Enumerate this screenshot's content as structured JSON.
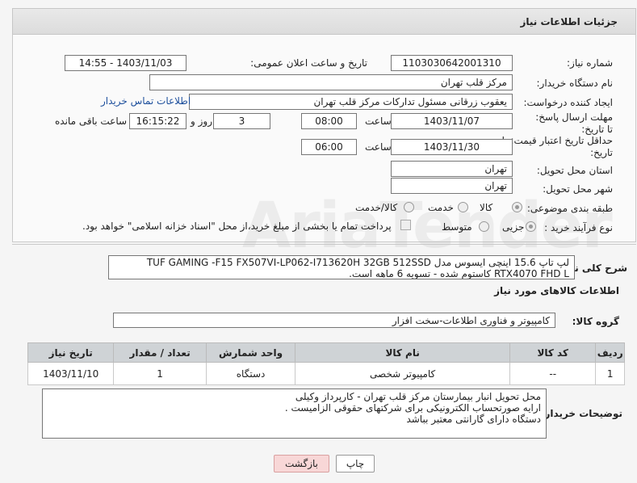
{
  "header": {
    "title": "جزئیات اطلاعات نیاز"
  },
  "fields": {
    "need_number_label": "شماره نیاز:",
    "need_number": "1103030642001310",
    "announce_label": "تاریخ و ساعت اعلان عمومی:",
    "announce_value": "1403/11/03 - 14:55",
    "buyer_org_label": "نام دستگاه خریدار:",
    "buyer_org": "مرکز قلب تهران",
    "creator_label": "ایجاد کننده درخواست:",
    "creator": "یعقوب زرقانی مسئول تدارکات مرکز قلب تهران",
    "contact_link": "اطلاعات تماس خریدار",
    "deadline_label": "مهلت ارسال پاسخ: تا تاریخ:",
    "deadline_date": "1403/11/07",
    "time_label": "ساعت",
    "deadline_time": "08:00",
    "days_value": "3",
    "days_label": "روز و",
    "remaining_time": "16:15:22",
    "remaining_label": "ساعت باقی مانده",
    "validity_label": "حداقل تاریخ اعتبار قیمت: تا تاریخ:",
    "validity_date": "1403/11/30",
    "validity_time": "06:00",
    "province_label": "استان محل تحویل:",
    "province": "تهران",
    "city_label": "شهر محل تحویل:",
    "city": "تهران",
    "category_label": "طبقه بندی موضوعی:",
    "category_options": [
      "کالا",
      "خدمت",
      "کالا/خدمت"
    ],
    "process_label": "نوع فرآیند خرید :",
    "process_options": [
      "جزیی",
      "متوسط"
    ],
    "payment_note": "پرداخت تمام یا بخشی از مبلغ خرید،از محل \"اسناد خزانه اسلامی\" خواهد بود."
  },
  "description": {
    "label": "شرح کلی نیاز:",
    "text": "لپ تاپ 15.6 اینچی ایسوس مدل TUF GAMING -F15 FX507VI-LP062-I713620H 32GB 512SSD RTX4070 FHD L کاستوم شده - تسویه 6 ماهه است."
  },
  "goods": {
    "section_title": "اطلاعات کالاهای مورد نیاز",
    "group_label": "گروه کالا:",
    "group_value": "کامپیوتر و فناوری اطلاعات-سخت افزار",
    "columns": [
      "ردیف",
      "کد کالا",
      "نام کالا",
      "واحد شمارش",
      "تعداد / مقدار",
      "تاریخ نیاز"
    ],
    "rows": [
      {
        "row": "1",
        "code": "--",
        "name": "کامپیوتر شخصی",
        "unit": "دستگاه",
        "qty": "1",
        "date": "1403/11/10"
      }
    ]
  },
  "buyer_notes": {
    "label": "توضیحات خریدار:",
    "lines": [
      "محل تحویل انبار بیمارستان مرکز قلب تهران - کارپرداز وکیلی",
      "ارایه صورتحساب الکترونیکی برای شرکتهای حقوقی الزامیست .",
      "دستگاه دارای گارانتی معتبر بباشد"
    ]
  },
  "buttons": {
    "print": "چاپ",
    "back": "بازگشت"
  },
  "colors": {
    "back_button_bg": "#f8d7d7",
    "print_button_bg": "#ffffff",
    "link": "#1d4f9c"
  }
}
